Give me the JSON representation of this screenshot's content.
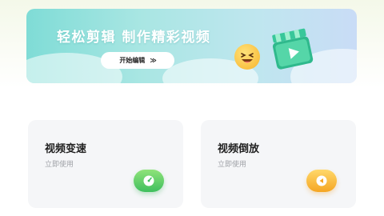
{
  "banner": {
    "title": "轻松剪辑 制作精彩视频",
    "start_button": "开始编辑",
    "start_arrows": "≫"
  },
  "cards": [
    {
      "title": "视频变速",
      "subtitle": "立即使用",
      "icon": "speed-gauge-icon",
      "accent": "#3fbf5e"
    },
    {
      "title": "视频倒放",
      "subtitle": "立即使用",
      "icon": "rewind-icon",
      "accent": "#f5a623"
    }
  ]
}
